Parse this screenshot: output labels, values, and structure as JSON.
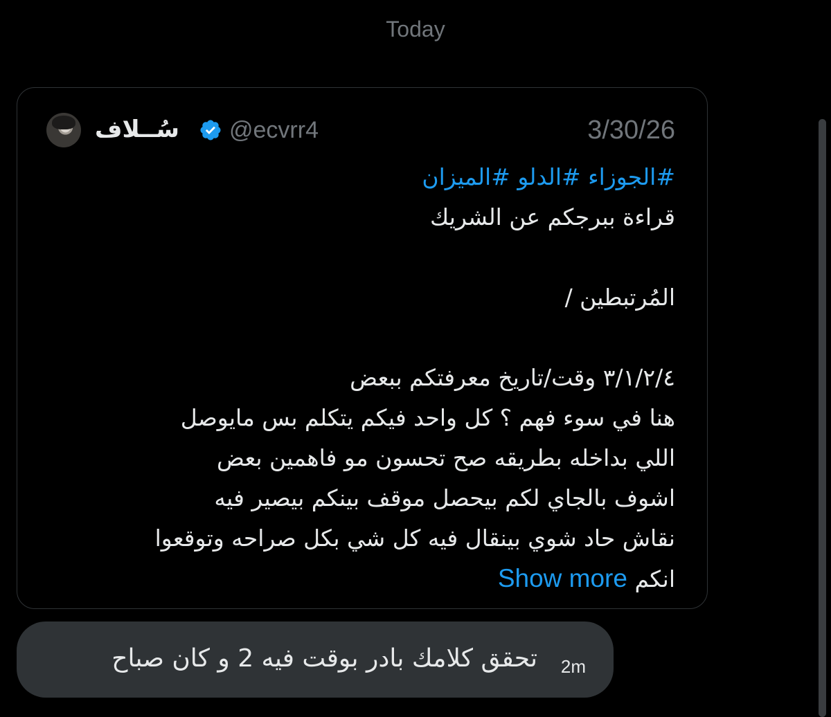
{
  "thread": {
    "day_label": "Today"
  },
  "quoted_post": {
    "author_name": "سُــلاف",
    "handle": "@ecvrr4",
    "date": "3/30/26",
    "verified": true,
    "accent_color": "#1d9bf0",
    "hashtags": "#الجوزاء #الدلو #الميزان",
    "lines": [
      "قراءة ببرجكم عن الشريك",
      "",
      "المُرتبطين /",
      "",
      "٣/١/٢/٤ وقت/تاريخ معرفتكم ببعض",
      "هنا في سوء فهم ؟ كل واحد فيكم يتكلم بس مايوصل",
      "اللي بداخله بطريقه صح تحسون مو فاهمين بعض",
      "اشوف بالجاي لكم بيحصل موقف بينكم بيصير فيه",
      "نقاش حاد شوي بينقال فيه كل شي بكل صراحه وتوقعوا"
    ],
    "last_line": "انكم",
    "show_more_label": "Show more"
  },
  "reply": {
    "text": "تحقق كلامك بادر بوقت فيه 2 و كان صباح",
    "time": "2m",
    "bubble_color": "#2f3336"
  }
}
